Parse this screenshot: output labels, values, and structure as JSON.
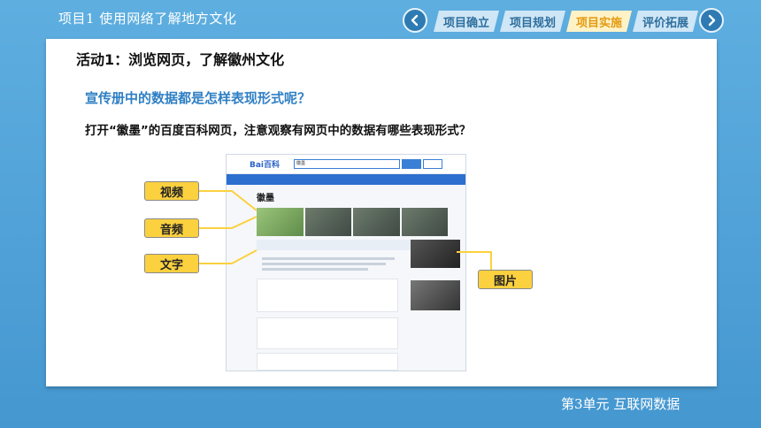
{
  "header": {
    "title": "项目1  使用网络了解地方文化",
    "tabs": [
      {
        "label": "项目确立",
        "active": false
      },
      {
        "label": "项目规划",
        "active": false
      },
      {
        "label": "项目实施",
        "active": true
      },
      {
        "label": "评价拓展",
        "active": false
      }
    ]
  },
  "main": {
    "activity_title": "活动1：浏览网页，了解徽州文化",
    "question_blue": "宣传册中的数据都是怎样表现形式呢？",
    "question_black": "打开“徽墨”的百度百科网页，注意观察有网页中的数据有哪些表现形式？",
    "screenshot": {
      "logo": "Bai百科",
      "entry": "徽墨",
      "search_value": "徽墨"
    },
    "labels": {
      "video": "视频",
      "audio": "音频",
      "text": "文字",
      "image": "图片"
    }
  },
  "footer": {
    "unit": "第3单元   互联网数据"
  },
  "colors": {
    "background": "#4a9fd6",
    "accent_active_tab": "#e39a10",
    "label_fill": "#fbd13f",
    "question_blue": "#2f7fc4"
  },
  "icons": {
    "prev": "chevron-left-icon",
    "next": "chevron-right-icon"
  }
}
